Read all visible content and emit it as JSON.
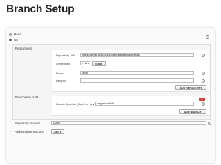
{
  "slide": {
    "title": "Branch Setup"
  },
  "scm": {
    "options": [
      {
        "label": "None",
        "selected": false
      },
      {
        "label": "Git",
        "selected": true
      }
    ]
  },
  "repositories": {
    "section_label": "Repositories",
    "url_label": "Repository URL",
    "url_value": "https://github.com/Skanko/jenkinsbestpractices.git",
    "credentials_label": "Credentials",
    "credentials_value": "- none -",
    "add_label": "Add",
    "name_label": "Name",
    "name_value": "origin",
    "refspec_label": "Refspec",
    "refspec_value": "",
    "add_repository_label": "ADD REPOSITORY"
  },
  "branches": {
    "section_label": "Branches to build",
    "delete_label": "X",
    "specifier_label": "Branch Specifier (blank for 'any')",
    "specifier_value": "origin/ready/**",
    "add_branch_label": "ADD BRANCH"
  },
  "repo_browser": {
    "label": "Repository browser",
    "value": "(Auto)"
  },
  "behaviours": {
    "label": "Additional Behaviours",
    "add_label": "ADD"
  },
  "help_glyph": "?"
}
